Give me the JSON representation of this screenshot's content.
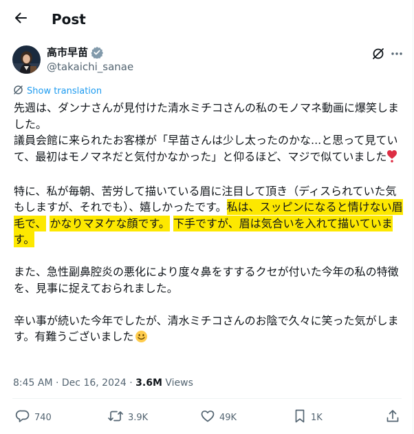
{
  "header": {
    "title": "Post"
  },
  "author": {
    "name": "高市早苗",
    "handle": "@takaichi_sanae"
  },
  "translate_label": "Show translation",
  "post": {
    "p1": "先週は、ダンナさんが見付けた清水ミチコさんの私のモノマネ動画に爆笑しました。",
    "p2": "議員会館に来られたお客様が「早苗さんは少し太ったのかな...と思って見ていて、最初はモノマネだと気付かなかった」と仰るほど、マジで似ていました",
    "p3_plain": "特に、私が毎朝、苦労して描いている眉に注目して頂き（ディスられていた気もしますが、それでも）、嬉しかったです。",
    "p3_hl1": "私は、スッピンになると情けない眉毛で、",
    "p3_hl2": "かなりマヌケな顔です。",
    "p3_hl3": "下手ですが、眉は気合いを入れて描いています。",
    "p4": "また、急性副鼻腔炎の悪化により度々鼻をすするクセが付いた今年の私の特徴を、見事に捉えておられました。",
    "p5": "辛い事が続いた今年でしたが、清水ミチコさんのお陰で久々に笑った気がします。有難うございました"
  },
  "meta": {
    "time": "8:45 AM",
    "sep": " · ",
    "date": "Dec 16, 2024",
    "sep2": " · ",
    "views_count": "3.6M",
    "views_label": " Views"
  },
  "actions": {
    "replies": "740",
    "reposts": "3.9K",
    "likes": "49K",
    "bookmarks": "1K"
  },
  "colors": {
    "highlight": "#fde800",
    "accent": "#1d9bf0",
    "muted": "#536471",
    "verified": "#829aab",
    "heart": "#dd2e44"
  },
  "icons": [
    "back-arrow-icon",
    "verified-badge-icon",
    "grok-icon",
    "more-icon",
    "translate-globe-icon",
    "heart-emoji-icon",
    "smile-emoji-icon",
    "reply-icon",
    "repost-icon",
    "like-icon",
    "bookmark-icon",
    "share-icon"
  ]
}
